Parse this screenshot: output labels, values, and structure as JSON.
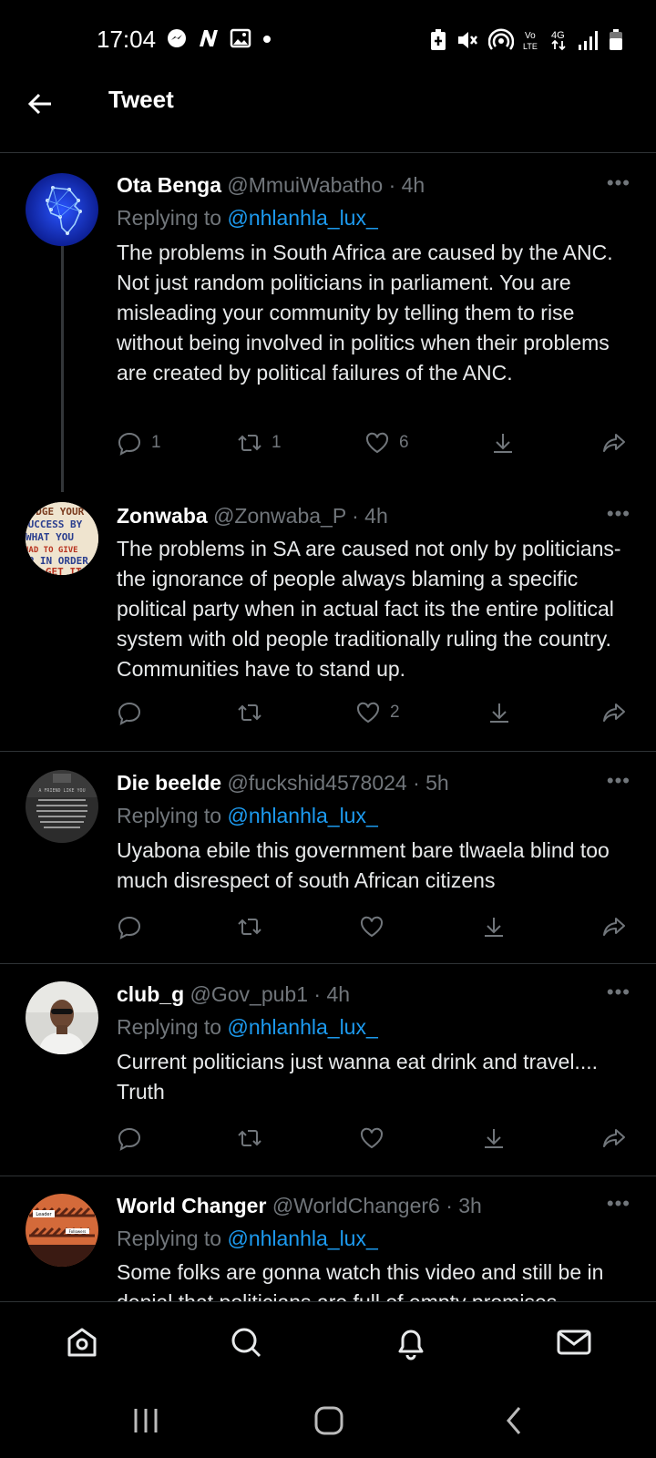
{
  "status_bar": {
    "time": "17:04",
    "left_icons": [
      "messenger-icon",
      "n-app-icon",
      "gallery-icon",
      "dot-icon"
    ],
    "right_icons": [
      "battery-saver-icon",
      "mute-icon",
      "hotspot-icon",
      "volte-icon",
      "4g-icon",
      "signal-icon",
      "battery-icon"
    ],
    "volte_label": "Vo LTE",
    "network_label": "4G"
  },
  "header": {
    "title": "Tweet"
  },
  "tweets": [
    {
      "name": "Ota Benga",
      "meta": "@MmuiWabatho · 4h",
      "replying_prefix": "Replying to ",
      "replying_to": "@nhlanhla_lux_",
      "text": "The problems  in South Africa are caused by the ANC. Not just random politicians in parliament. You are misleading your community by telling them to rise without being involved in politics when their problems are created by political failures  of the ANC.",
      "replies": "1",
      "retweets": "1",
      "likes": "6"
    },
    {
      "name": "Zonwaba",
      "meta": "@Zonwaba_P · 4h",
      "text": "The problems in SA are caused not only by politicians-the ignorance of people always blaming a specific political party when in actual fact its the entire political system with old people traditionally ruling the country. Communities have to stand up.",
      "replies": "",
      "retweets": "",
      "likes": "2"
    },
    {
      "name": "Die beelde",
      "meta": "@fuckshid4578024 · 5h",
      "replying_prefix": "Replying to ",
      "replying_to": "@nhlanhla_lux_",
      "text": "Uyabona ebile this government bare tlwaela blind too much disrespect of south African citizens",
      "replies": "",
      "retweets": "",
      "likes": ""
    },
    {
      "name": "club_g",
      "meta": "@Gov_pub1 · 4h",
      "replying_prefix": "Replying to ",
      "replying_to": "@nhlanhla_lux_",
      "text": "Current politicians just wanna eat drink and travel.... Truth",
      "replies": "",
      "retweets": "",
      "likes": ""
    },
    {
      "name": "World Changer",
      "meta": "@WorldChanger6 · 3h",
      "replying_prefix": "Replying to ",
      "replying_to": "@nhlanhla_lux_",
      "text": "Some folks are gonna watch this video and still be in denial that politicians are full of empty promises"
    }
  ],
  "avatars": {
    "zonwaba_sign_text": "JUDGE YOUR SUCCESS BY WHAT YOU HAD TO GIVE UP IN ORDER TO GET IT",
    "die_beelde_caption": "A FRIEND LIKE YOU",
    "world_changer_labels": [
      "Leader",
      "Followers"
    ]
  },
  "bottom_nav": [
    "home-icon",
    "search-icon",
    "notifications-icon",
    "messages-icon"
  ],
  "colors": {
    "accent": "#1d9bf0",
    "muted": "#71767b",
    "text": "#e7e9ea",
    "divider": "#2f3336"
  }
}
